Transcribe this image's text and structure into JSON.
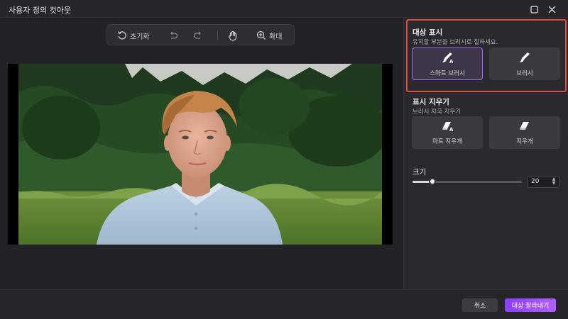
{
  "window": {
    "title": "사용자 정의 컷아웃",
    "maximize_icon": "maximize-icon",
    "close_icon": "close-icon"
  },
  "toolbar": {
    "reset_label": "초기화",
    "zoom_label": "확대",
    "icons": [
      "reset-icon",
      "undo-icon",
      "redo-icon",
      "hand-icon",
      "zoom-in-icon"
    ]
  },
  "panel": {
    "mark_target": {
      "title": "대상 표시",
      "subtitle": "유지할 부분을 브러시로 칠하세요.",
      "options": [
        {
          "label": "스마트 브러시",
          "icon": "smart-brush-icon",
          "selected": true
        },
        {
          "label": "브러시",
          "icon": "brush-icon",
          "selected": false
        }
      ]
    },
    "erase_mark": {
      "title": "표시 지우기",
      "subtitle": "브러시 자국 지우기",
      "options": [
        {
          "label": "마트 지우개",
          "icon": "smart-eraser-icon"
        },
        {
          "label": "지우개",
          "icon": "eraser-icon"
        }
      ]
    },
    "size": {
      "title": "크기",
      "value": "20",
      "slider_fraction": 0.18
    }
  },
  "footer": {
    "cancel_label": "취소",
    "confirm_label": "대상 잘라내기"
  },
  "colors": {
    "accent": "#a66cff",
    "highlight_border": "#e04b3b",
    "primary_button": "#9a47ff"
  }
}
